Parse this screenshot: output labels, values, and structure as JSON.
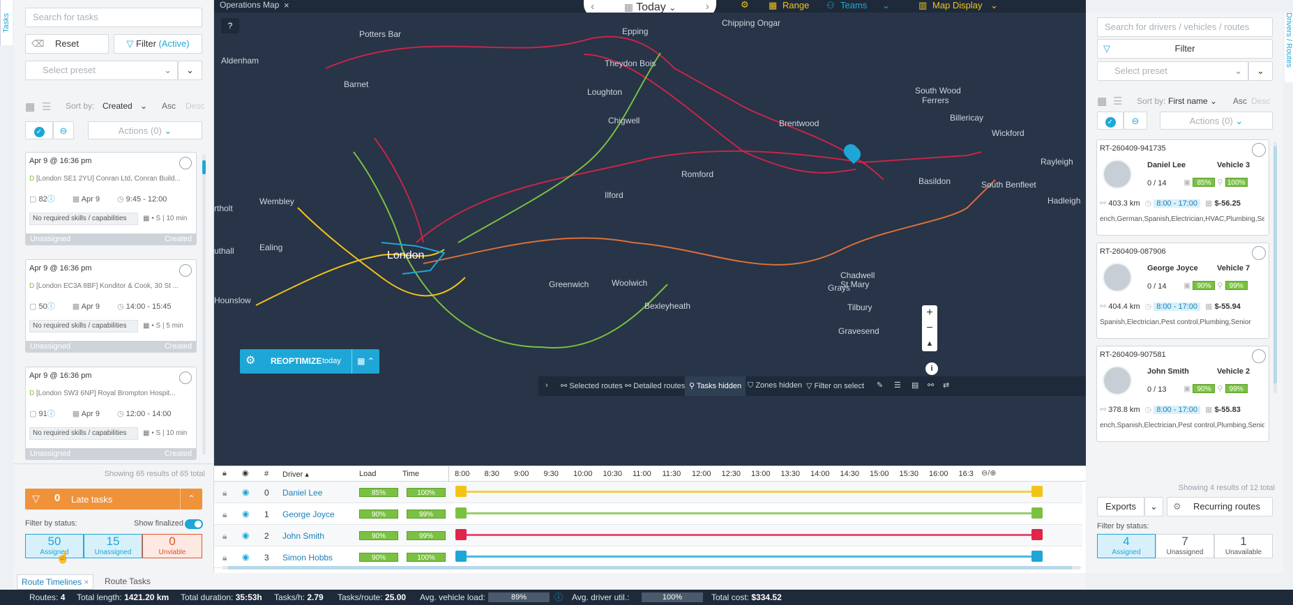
{
  "left_tab": "Tasks",
  "right_tab": "Drivers / Routes",
  "left": {
    "search_placeholder": "Search for tasks",
    "reset": "Reset",
    "filter": "Filter",
    "filter_state": "(Active)",
    "preset_placeholder": "Select preset",
    "sort_label": "Sort by:",
    "sort_value": "Created",
    "asc": "Asc",
    "desc": "Desc",
    "actions": "Actions (0)",
    "tasks": [
      {
        "date": "Apr 9 @ 16:36 pm",
        "address": "[London SE1 2YU] Conran Ltd, Conran Build...",
        "num": "82",
        "day": "Apr 9",
        "time": "9:45 - 12:00",
        "skills": "No required skills / capabilities",
        "dur": "• S | 10 min",
        "status": "Unassigned",
        "state": "Created"
      },
      {
        "date": "Apr 9 @ 16:36 pm",
        "address": "[London EC3A 8BF] Konditor & Cook, 30 St ...",
        "num": "50",
        "day": "Apr 9",
        "time": "14:00 - 15:45",
        "skills": "No required skills / capabilities",
        "dur": "• S | 5 min",
        "status": "Unassigned",
        "state": "Created"
      },
      {
        "date": "Apr 9 @ 16:36 pm",
        "address": "[London SW3 6NP] Royal Brompton Hospit...",
        "num": "91",
        "day": "Apr 9",
        "time": "12:00 - 14:00",
        "skills": "No required skills / capabilities",
        "dur": "• S | 10 min",
        "status": "Unassigned",
        "state": "Created"
      }
    ],
    "showing": "Showing 65 results of 65 total",
    "late_count": "0",
    "late_label": "Late tasks",
    "filter_by_status": "Filter by status:",
    "show_finalized": "Show finalized",
    "tiles": [
      {
        "n": "50",
        "label": "Assigned"
      },
      {
        "n": "15",
        "label": "Unassigned"
      },
      {
        "n": "0",
        "label": "Unviable"
      }
    ]
  },
  "top": {
    "tab_title": "Operations Map",
    "today": "Today",
    "range": "Range",
    "teams": "Teams",
    "map_display": "Map Display"
  },
  "map": {
    "places": [
      "Potters Bar",
      "Epping",
      "Chipping Ongar",
      "Aldenham",
      "Theydon Bois",
      "Barnet",
      "Loughton",
      "South Wood",
      "Ferrers",
      "Chigwell",
      "Billericay",
      "Brentwood",
      "Wickford",
      "Rayleigh",
      "Romford",
      "Wembley",
      "Ilford",
      "Basildon",
      "South Benfleet",
      "Hadleigh",
      "rtholt",
      "uthall",
      "Ealing",
      "London",
      "Chadwell",
      "St Mary",
      "Greenwich",
      "Woolwich",
      "Grays",
      "Hounslow",
      "Bexleyheath",
      "Tilbury",
      "Gravesend"
    ],
    "reoptimize": "REOPTIMIZE",
    "reopt_sub": "today",
    "toolbar": [
      "Selected routes",
      "Detailed routes",
      "Tasks hidden",
      "Zones hidden",
      "Filter on select"
    ]
  },
  "timeline": {
    "headers": {
      "num": "#",
      "driver": "Driver",
      "load": "Load",
      "time": "Time"
    },
    "hours": [
      "8:00",
      "8:30",
      "9:00",
      "9:30",
      "10:00",
      "10:30",
      "11:00",
      "11:30",
      "12:00",
      "12:30",
      "13:00",
      "13:30",
      "14:00",
      "14:30",
      "15:00",
      "15:30",
      "16:00",
      "16:3"
    ],
    "rows": [
      {
        "idx": "0",
        "name": "Daniel Lee",
        "load": "85%",
        "time": "100%",
        "color": "#f2c418"
      },
      {
        "idx": "1",
        "name": "George Joyce",
        "load": "90%",
        "time": "99%",
        "color": "#7ac142"
      },
      {
        "idx": "2",
        "name": "John Smith",
        "load": "90%",
        "time": "99%",
        "color": "#e0244a"
      },
      {
        "idx": "3",
        "name": "Simon Hobbs",
        "load": "90%",
        "time": "100%",
        "color": "#1ea7d6"
      }
    ],
    "tabs": [
      "Route Timelines",
      "Route Tasks"
    ]
  },
  "right": {
    "search_placeholder": "Search for drivers / vehicles / routes",
    "filter": "Filter",
    "preset_placeholder": "Select preset",
    "sort_label": "Sort by:",
    "sort_value": "First name",
    "asc": "Asc",
    "desc": "Desc",
    "actions": "Actions (0)",
    "routes": [
      {
        "id": "RT-260409-941735",
        "name": "Daniel Lee",
        "vehicle": "Vehicle 3",
        "tasks": "0 / 14",
        "load": "85%",
        "time": "100%",
        "km": "403.3 km",
        "hours": "8:00 - 17:00",
        "cost": "$-56.25",
        "skills": "ench,German,Spanish,Electrician,HVAC,Plumbing,Sen"
      },
      {
        "id": "RT-260409-087906",
        "name": "George Joyce",
        "vehicle": "Vehicle 7",
        "tasks": "0 / 14",
        "load": "90%",
        "time": "99%",
        "km": "404.4 km",
        "hours": "8:00 - 17:00",
        "cost": "$-55.94",
        "skills": "Spanish,Electrician,Pest control,Plumbing,Senior"
      },
      {
        "id": "RT-260409-907581",
        "name": "John Smith",
        "vehicle": "Vehicle 2",
        "tasks": "0 / 13",
        "load": "90%",
        "time": "99%",
        "km": "378.8 km",
        "hours": "8:00 - 17:00",
        "cost": "$-55.83",
        "skills": "ench,Spanish,Electrician,Pest control,Plumbing,Senic"
      }
    ],
    "showing": "Showing 4 results of 12 total",
    "exports": "Exports",
    "recurring": "Recurring routes",
    "filter_by_status": "Filter by status:",
    "tiles": [
      {
        "n": "4",
        "label": "Assigned"
      },
      {
        "n": "7",
        "label": "Unassigned"
      },
      {
        "n": "1",
        "label": "Unavailable"
      }
    ]
  },
  "status": {
    "routes_l": "Routes:",
    "routes": "4",
    "length_l": "Total length:",
    "length": "1421.20 km",
    "dur_l": "Total duration:",
    "dur": "35:53h",
    "tph_l": "Tasks/h:",
    "tph": "2.79",
    "tpr_l": "Tasks/route:",
    "tpr": "25.00",
    "load_l": "Avg. vehicle load:",
    "load": "89%",
    "util_l": "Avg. driver util.:",
    "util": "100%",
    "cost_l": "Total cost:",
    "cost": "$334.52"
  }
}
